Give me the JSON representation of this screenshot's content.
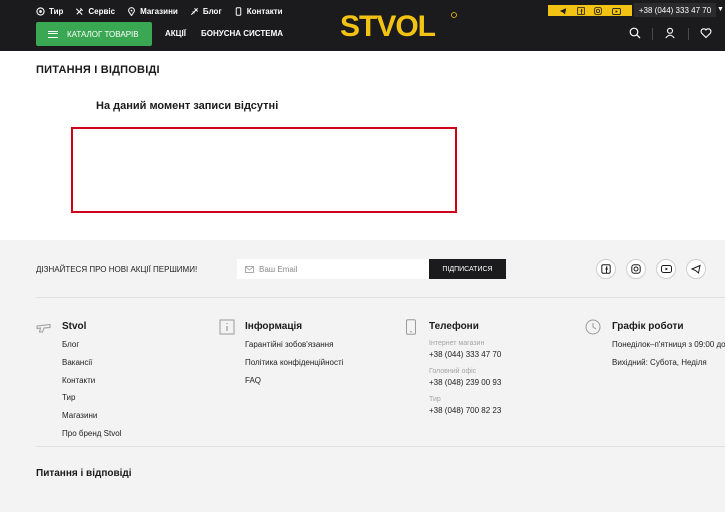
{
  "header": {
    "top_links": [
      {
        "label": "Тир",
        "icon": "target-icon"
      },
      {
        "label": "Сервіс",
        "icon": "wrench-icon"
      },
      {
        "label": "Магазини",
        "icon": "map-pin-icon"
      },
      {
        "label": "Блог",
        "icon": "megaphone-icon"
      },
      {
        "label": "Контакти",
        "icon": "phone-icon"
      }
    ],
    "logo_text": "STVOL",
    "phone": "+38 (044) 333 47 70",
    "catalog_button": "КАТАЛОГ ТОВАРІВ",
    "nav": [
      "АКЦІЇ",
      "БОНУСНА СИСТЕМА"
    ],
    "accent_color": "#f2c312",
    "brand_green": "#3aa853"
  },
  "main": {
    "title": "ПИТАННЯ І ВІДПОВІДІ",
    "empty_message": "На даний момент записи відсутні",
    "highlight_color": "#d0021b"
  },
  "footer": {
    "subscribe_label": "ДІЗНАЙТЕСЯ ПРО НОВІ АКЦІЇ ПЕРШИМИ!",
    "email_placeholder": "Ваш Email",
    "subscribe_button": "ПІДПИСАТИСЯ",
    "socials": [
      "facebook-icon",
      "instagram-icon",
      "youtube-icon",
      "telegram-icon"
    ],
    "columns": {
      "stvol": {
        "title": "Stvol",
        "links": [
          "Блог",
          "Вакансії",
          "Контакти",
          "Тир",
          "Магазини",
          "Про бренд Stvol"
        ]
      },
      "info": {
        "title": "Інформація",
        "links": [
          "Гарантійні зобов'язання",
          "Політика конфіденційності",
          "FAQ"
        ]
      },
      "phones": {
        "title": "Телефони",
        "entries": [
          {
            "label": "Інтернет магазин",
            "value": "+38 (044) 333 47 70"
          },
          {
            "label": "Головний офіс",
            "value": "+38 (048) 239 00 93"
          },
          {
            "label": "Тир",
            "value": "+38 (048) 700 82 23"
          }
        ]
      },
      "schedule": {
        "title": "Графік роботи",
        "lines": [
          "Понеділок–п'ятниця з 09:00 до",
          "Вихідний: Субота, Неділя"
        ]
      }
    },
    "bottom_title": "Питання і відповіді"
  }
}
